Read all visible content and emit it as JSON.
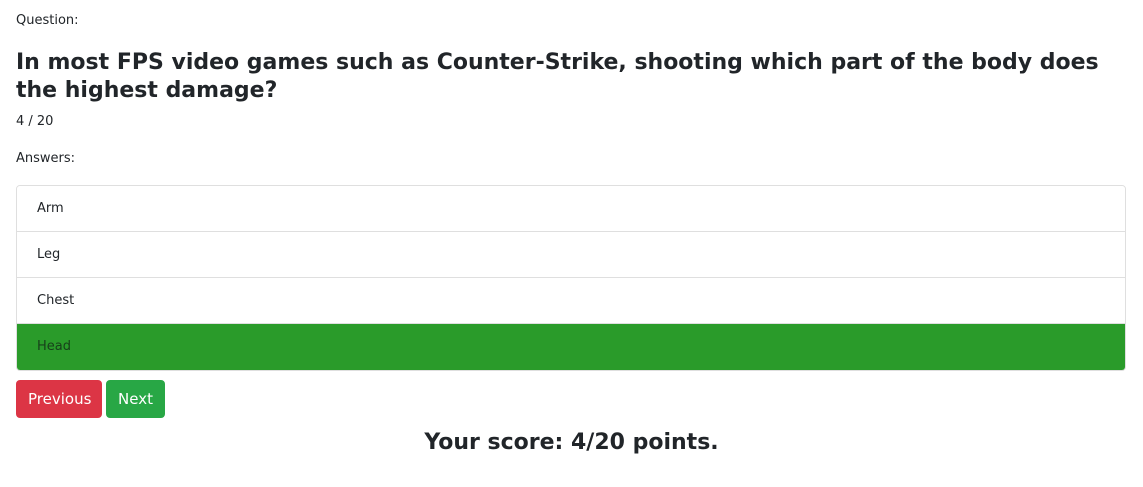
{
  "quiz": {
    "question_label": "Question:",
    "question_text": "In most FPS video games such as Counter-Strike, shooting which part of the body does the highest damage?",
    "progress": "4 / 20",
    "answers_label": "Answers:",
    "answers": [
      {
        "label": "Arm",
        "state": "default"
      },
      {
        "label": "Leg",
        "state": "default"
      },
      {
        "label": "Chest",
        "state": "default"
      },
      {
        "label": "Head",
        "state": "correct"
      }
    ],
    "correct_color": "#2a9b2a"
  },
  "buttons": {
    "previous_label": "Previous",
    "next_label": "Next",
    "previous_color": "#dc3545",
    "next_color": "#28a745"
  },
  "score": {
    "text": "Your score: 4/20 points."
  }
}
